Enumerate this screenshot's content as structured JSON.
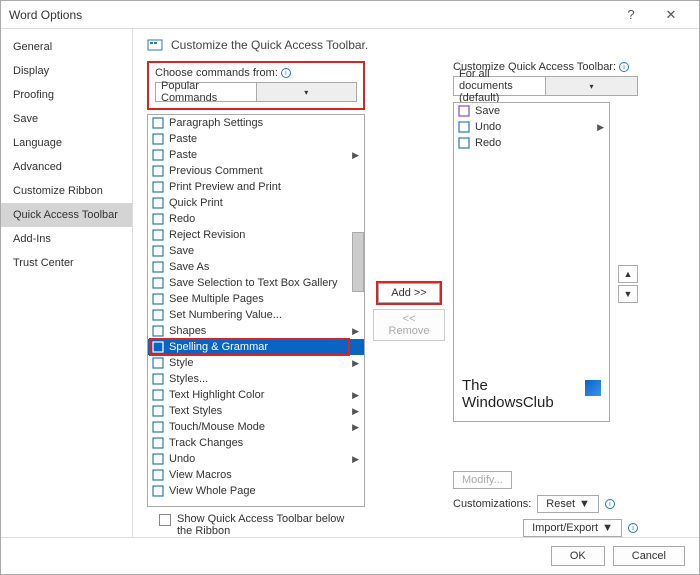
{
  "title": "Word Options",
  "heading": "Customize the Quick Access Toolbar.",
  "sidebar": {
    "items": [
      {
        "label": "General"
      },
      {
        "label": "Display"
      },
      {
        "label": "Proofing"
      },
      {
        "label": "Save"
      },
      {
        "label": "Language"
      },
      {
        "label": "Advanced"
      },
      {
        "label": "Customize Ribbon"
      },
      {
        "label": "Quick Access Toolbar"
      },
      {
        "label": "Add-Ins"
      },
      {
        "label": "Trust Center"
      }
    ],
    "selected": 7
  },
  "choose": {
    "label": "Choose commands from:",
    "value": "Popular Commands"
  },
  "customize": {
    "label": "Customize Quick Access Toolbar:",
    "value": "For all documents (default)"
  },
  "commands": [
    {
      "label": "Paragraph Settings"
    },
    {
      "label": "Paste"
    },
    {
      "label": "Paste",
      "arrow": true
    },
    {
      "label": "Previous Comment"
    },
    {
      "label": "Print Preview and Print"
    },
    {
      "label": "Quick Print"
    },
    {
      "label": "Redo"
    },
    {
      "label": "Reject Revision"
    },
    {
      "label": "Save"
    },
    {
      "label": "Save As"
    },
    {
      "label": "Save Selection to Text Box Gallery"
    },
    {
      "label": "See Multiple Pages"
    },
    {
      "label": "Set Numbering Value..."
    },
    {
      "label": "Shapes",
      "arrow": true
    },
    {
      "label": "Spelling & Grammar",
      "selected": true
    },
    {
      "label": "Style",
      "arrow": true
    },
    {
      "label": "Styles..."
    },
    {
      "label": "Text Highlight Color",
      "arrow": true
    },
    {
      "label": "Text Styles",
      "arrow": true
    },
    {
      "label": "Touch/Mouse Mode",
      "arrow": true
    },
    {
      "label": "Track Changes"
    },
    {
      "label": "Undo",
      "arrow": true
    },
    {
      "label": "View Macros"
    },
    {
      "label": "View Whole Page"
    }
  ],
  "right_list": [
    {
      "label": "Save"
    },
    {
      "label": "Undo",
      "arrow": true
    },
    {
      "label": "Redo"
    }
  ],
  "buttons": {
    "add": "Add >>",
    "remove": "<< Remove",
    "modify": "Modify...",
    "ok": "OK",
    "cancel": "Cancel"
  },
  "reset": {
    "label": "Customizations:",
    "btn": "Reset",
    "imp": "Import/Export"
  },
  "checkbox": "Show Quick Access Toolbar below the Ribbon",
  "logo": {
    "l1": "The",
    "l2": "WindowsClub"
  }
}
